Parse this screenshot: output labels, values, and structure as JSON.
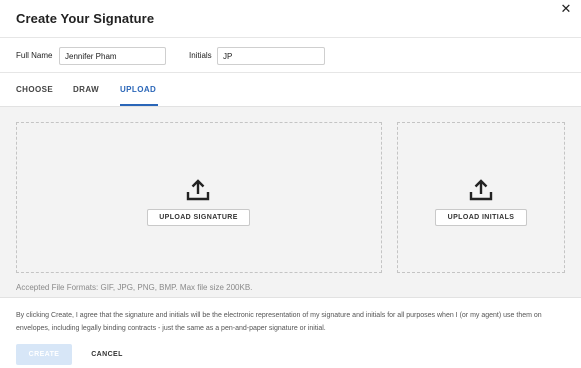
{
  "dialog": {
    "title": "Create Your Signature",
    "close_icon": "close-icon"
  },
  "fields": {
    "full_name_label": "Full Name",
    "full_name_value": "Jennifer Pham",
    "initials_label": "Initials",
    "initials_value": "JP"
  },
  "tabs": [
    {
      "label": "CHOOSE",
      "active": false
    },
    {
      "label": "DRAW",
      "active": false
    },
    {
      "label": "UPLOAD",
      "active": true
    }
  ],
  "upload": {
    "signature_button": "UPLOAD SIGNATURE",
    "initials_button": "UPLOAD INITIALS",
    "icon": "upload-icon",
    "formats_note": "Accepted File Formats: GIF, JPG, PNG, BMP. Max file size 200KB."
  },
  "footer": {
    "consent_text": "By clicking Create, I agree that the signature and initials will be the electronic representation of my signature and initials for all purposes when I (or my agent) use them on envelopes, including legally binding contracts - just the same as a pen-and-paper signature or initial.",
    "create_label": "CREATE",
    "cancel_label": "CANCEL"
  },
  "colors": {
    "accent": "#2a66b8",
    "create_disabled_bg": "#d7e6f7",
    "content_bg": "#f3f3f3"
  }
}
